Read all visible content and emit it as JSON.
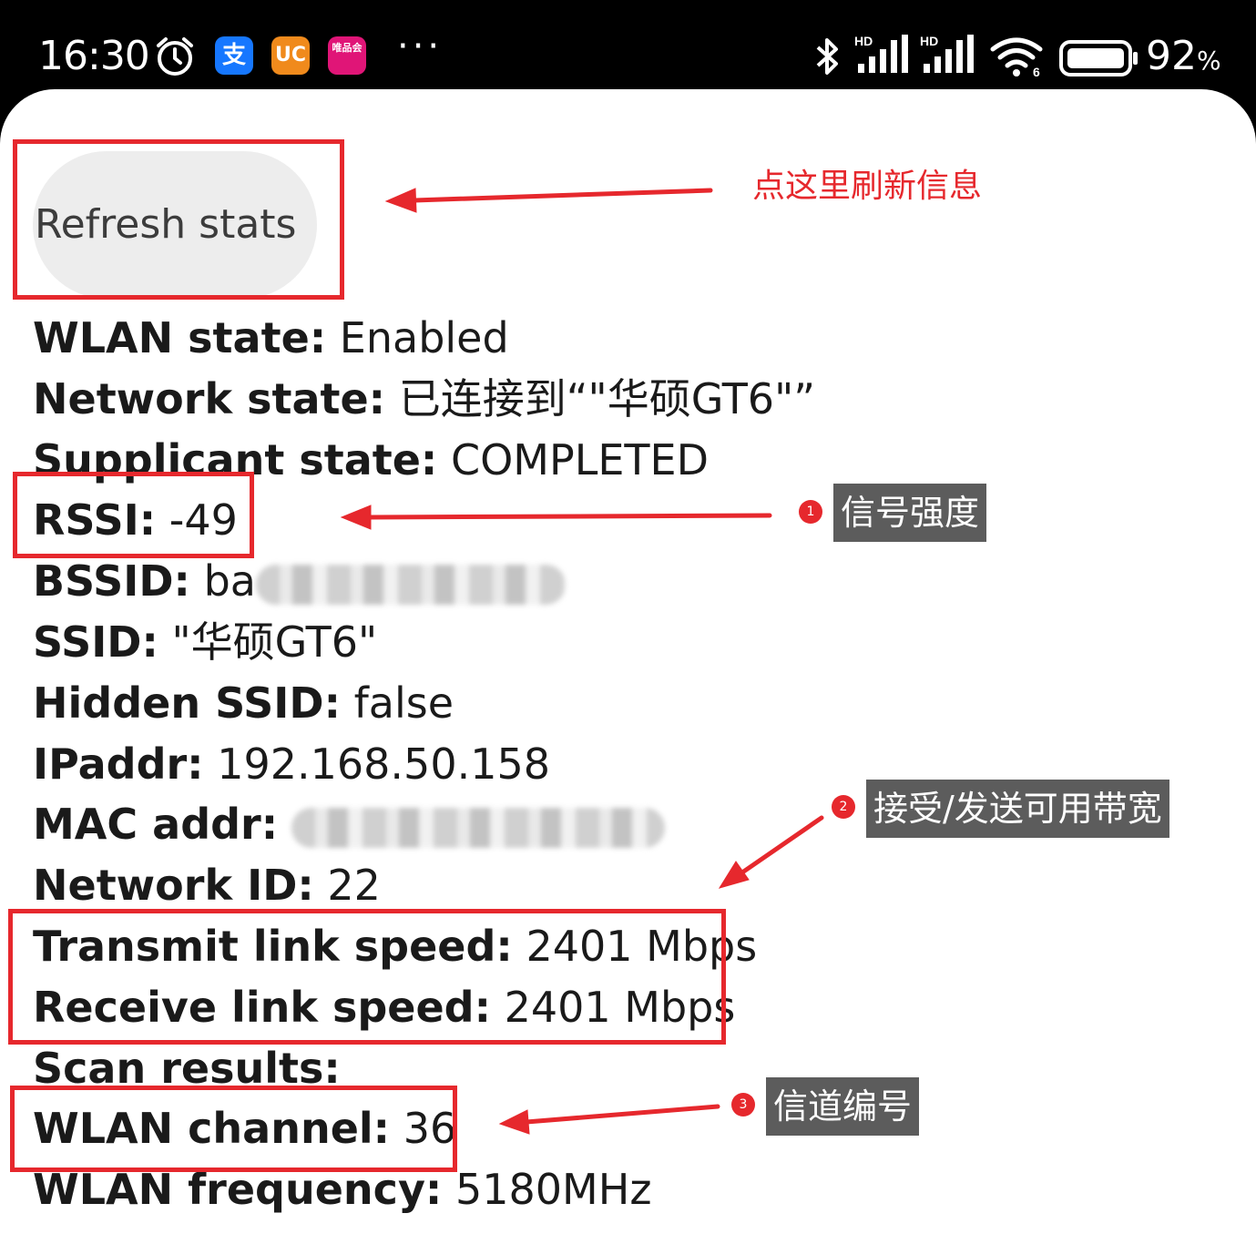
{
  "status_bar": {
    "time": "16:30",
    "alarm_icon": "alarm-clock-icon",
    "apps": [
      {
        "name": "alipay-app-icon",
        "glyph": "支"
      },
      {
        "name": "uc-browser-app-icon",
        "glyph": "UC"
      },
      {
        "name": "vipshop-app-icon",
        "glyph": "唯品会"
      }
    ],
    "more": "···",
    "indicators": [
      "bluetooth-icon",
      "signal-hd-icon",
      "signal-hd-icon",
      "wifi6-icon",
      "battery-icon"
    ],
    "battery_percent": "92",
    "battery_unit": "%"
  },
  "refresh_button": {
    "label": "Refresh stats"
  },
  "stats": [
    {
      "key": "WLAN state:",
      "value": "Enabled"
    },
    {
      "key": "Network state:",
      "value": "已连接到“\"华硕GT6\"”"
    },
    {
      "key": "Supplicant state:",
      "value": "COMPLETED"
    },
    {
      "key": "RSSI:",
      "value": "-49"
    },
    {
      "key": "BSSID:",
      "value": "ba"
    },
    {
      "key": "SSID:",
      "value": "\"华硕GT6\""
    },
    {
      "key": "Hidden SSID:",
      "value": "false"
    },
    {
      "key": "IPaddr:",
      "value": "192.168.50.158"
    },
    {
      "key": "MAC addr:",
      "value": ""
    },
    {
      "key": "Network ID:",
      "value": "22"
    },
    {
      "key": "Transmit link speed:",
      "value": "2401 Mbps"
    },
    {
      "key": "Receive link speed:",
      "value": "2401 Mbps"
    },
    {
      "key": "Scan results:",
      "value": ""
    },
    {
      "key": "WLAN channel:",
      "value": "36"
    },
    {
      "key": "WLAN frequency:",
      "value": "5180MHz"
    }
  ],
  "annotations": {
    "refresh_note": "点这里刷新信息",
    "signal": {
      "num": "1",
      "text": "信号强度"
    },
    "bandwidth": {
      "num": "2",
      "text": "接受/发送可用带宽"
    },
    "channel": {
      "num": "3",
      "text": "信道编号"
    },
    "accent_color": "#e6282d"
  }
}
